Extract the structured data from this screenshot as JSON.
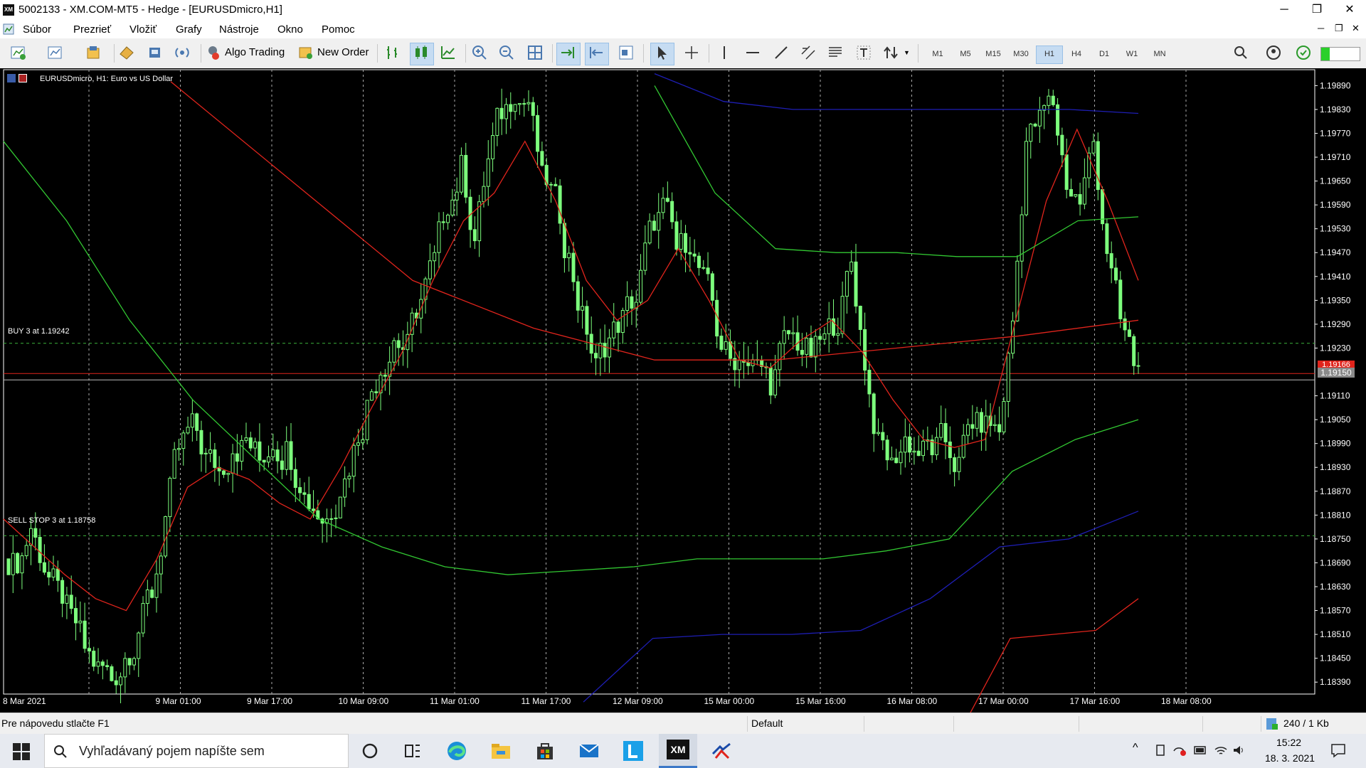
{
  "window": {
    "title": "5002133 - XM.COM-MT5 - Hedge - [EURUSDmicro,H1]",
    "logo_text": "XM",
    "minimize": "─",
    "restore": "❐",
    "close": "✕"
  },
  "menu": [
    "Súbor",
    "Prezrieť",
    "Vložiť",
    "Grafy",
    "Nástroje",
    "Okno",
    "Pomoc"
  ],
  "toolbar": {
    "algo_trading": "Algo Trading",
    "new_order": "New Order",
    "timeframes": [
      "M1",
      "M5",
      "M15",
      "M30",
      "H1",
      "H4",
      "D1",
      "W1",
      "MN"
    ],
    "active_timeframe": "H1"
  },
  "chart": {
    "header": "EURUSDmicro, H1:  Euro vs US Dollar",
    "orders": [
      {
        "label": "BUY 3 at 1.19242",
        "price": 1.19242
      },
      {
        "label": "SELL STOP 3 at 1.18758",
        "price": 1.18758
      }
    ],
    "bid_price": "1.19150",
    "ask_price": "1.19166",
    "colors": {
      "background": "#000000",
      "bull": "#7dff7d",
      "bear": "#7dff7d",
      "ma_red": "#e0241c",
      "ma_green": "#32c832",
      "ma_blue": "#1e1eb4"
    }
  },
  "chart_data": {
    "type": "candlestick",
    "symbol": "EURUSDmicro",
    "timeframe": "H1",
    "y_ticks": [
      "1.19890",
      "1.19830",
      "1.19770",
      "1.19710",
      "1.19650",
      "1.19590",
      "1.19530",
      "1.19470",
      "1.19410",
      "1.19350",
      "1.19290",
      "1.19230",
      "1.19150",
      "1.19110",
      "1.19050",
      "1.18990",
      "1.18930",
      "1.18870",
      "1.18810",
      "1.18750",
      "1.18690",
      "1.18630",
      "1.18570",
      "1.18510",
      "1.18450",
      "1.18390"
    ],
    "ylim": [
      1.1836,
      1.1993
    ],
    "x_ticks": [
      "8 Mar 2021",
      "9 Mar 01:00",
      "9 Mar 17:00",
      "10 Mar 09:00",
      "11 Mar 01:00",
      "11 Mar 17:00",
      "12 Mar 09:00",
      "15 Mar 00:00",
      "15 Mar 16:00",
      "16 Mar 08:00",
      "17 Mar 00:00",
      "17 Mar 16:00",
      "18 Mar 08:00"
    ],
    "close_path": [
      1.187,
      1.1878,
      1.1868,
      1.1862,
      1.1855,
      1.1848,
      1.1842,
      1.184,
      1.1845,
      1.1852,
      1.1862,
      1.188,
      1.1898,
      1.1903,
      1.1895,
      1.1892,
      1.1898,
      1.19,
      1.1895,
      1.19,
      1.1897,
      1.189,
      1.1883,
      1.188,
      1.1888,
      1.1897,
      1.1908,
      1.1918,
      1.1925,
      1.1923,
      1.1935,
      1.1945,
      1.196,
      1.1968,
      1.195,
      1.197,
      1.1983,
      1.1988,
      1.1985,
      1.1965,
      1.196,
      1.1945,
      1.193,
      1.1918,
      1.1925,
      1.193,
      1.1935,
      1.1952,
      1.1958,
      1.1948,
      1.195,
      1.194,
      1.1928,
      1.192,
      1.1922,
      1.1918,
      1.1915,
      1.1925,
      1.1925,
      1.1922,
      1.1925,
      1.193,
      1.1945,
      1.192,
      1.1898,
      1.1893,
      1.19,
      1.1897,
      1.1898,
      1.19,
      1.1893,
      1.1905,
      1.1903,
      1.1902,
      1.193,
      1.1975,
      1.198,
      1.1985,
      1.1965,
      1.196,
      1.1975,
      1.1948,
      1.193,
      1.192,
      1.1915
    ],
    "ma_red": [
      1.188,
      1.1873,
      1.1866,
      1.186,
      1.1857,
      1.187,
      1.1888,
      1.1893,
      1.189,
      1.1884,
      1.188,
      1.1893,
      1.1908,
      1.1922,
      1.194,
      1.1955,
      1.1962,
      1.1975,
      1.196,
      1.194,
      1.193,
      1.1935,
      1.1948,
      1.1935,
      1.192,
      1.1918,
      1.1925,
      1.193,
      1.1922,
      1.191,
      1.19,
      1.1898,
      1.19,
      1.193,
      1.196,
      1.1978,
      1.196,
      1.194
    ],
    "ma_green": [
      1.1975,
      1.1955,
      1.193,
      1.191,
      1.1895,
      1.188,
      1.1873,
      1.1868,
      1.1866,
      1.1867,
      1.1868,
      1.187,
      1.187,
      1.187,
      1.1872,
      1.1875,
      1.1892,
      1.19,
      1.1905
    ],
    "ma_green_upper": [
      1.1989,
      1.1962,
      1.1948,
      1.1947,
      1.1947,
      1.1946,
      1.1946,
      1.1955,
      1.1956
    ],
    "ma_blue_upper": [
      1.1992,
      1.1985,
      1.1983,
      1.1983,
      1.1983,
      1.1983,
      1.1983,
      1.1982
    ],
    "ma_blue_lower": [
      1.1834,
      1.185,
      1.1851,
      1.1851,
      1.1852,
      1.186,
      1.1873,
      1.1875,
      1.1882
    ],
    "ma_red_upper": [
      1.199,
      1.1965,
      1.194,
      1.1928,
      1.192,
      1.192,
      1.1923,
      1.1926,
      1.193
    ],
    "ma_red_lower": [
      1.183,
      1.185,
      1.1851,
      1.1852,
      1.186
    ]
  },
  "statusbar": {
    "help": "Pre nápovedu stlačte F1",
    "profile": "Default",
    "traffic": "240 / 1 Kb"
  },
  "taskbar": {
    "search_placeholder": "Vyhľadávaný pojem napíšte sem",
    "time": "15:22",
    "date": "18. 3. 2021",
    "app_labels": [
      "XM"
    ]
  }
}
